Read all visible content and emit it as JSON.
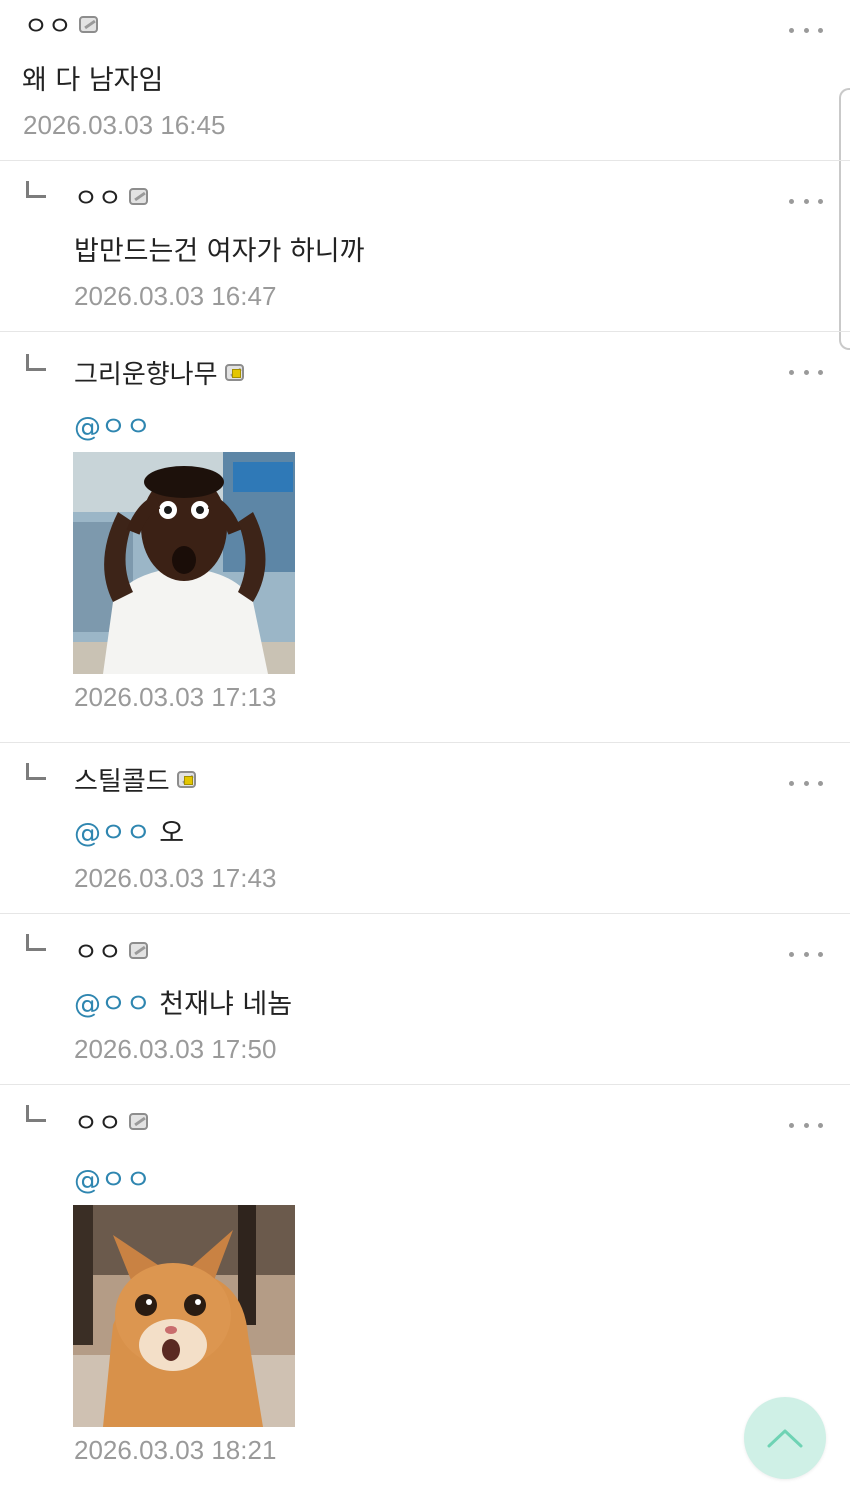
{
  "comments": [
    {
      "author": "ㅇㅇ",
      "mention": "",
      "text": "왜 다 남자임",
      "date": "2026.03.03 16:45"
    },
    {
      "author": "ㅇㅇ",
      "mention": "",
      "text": "밥만드는건 여자가 하니까",
      "date": "2026.03.03 16:47"
    },
    {
      "author": "그리운향나무",
      "mention": "@ㅇㅇ",
      "text": "",
      "image": "shocked-man-photo",
      "date": "2026.03.03 17:13"
    },
    {
      "author": "스틸콜드",
      "mention": "@ㅇㅇ",
      "text": "오",
      "date": "2026.03.03 17:43"
    },
    {
      "author": "ㅇㅇ",
      "mention": "@ㅇㅇ",
      "text": "천재냐 네놈",
      "date": "2026.03.03 17:50"
    },
    {
      "author": "ㅇㅇ",
      "mention": "@ㅇㅇ",
      "text": "",
      "image": "shocked-cat-photo",
      "date": "2026.03.03 18:21"
    }
  ],
  "icons": {
    "reply": "reply-arrow-icon",
    "more": "more-options-icon",
    "level": "member-level-icon",
    "top": "scroll-to-top-icon"
  },
  "colors": {
    "mention": "#2f86b0",
    "date": "#9a9a9a",
    "divider": "#e6e6e6",
    "top_button": "#cff0e6"
  }
}
